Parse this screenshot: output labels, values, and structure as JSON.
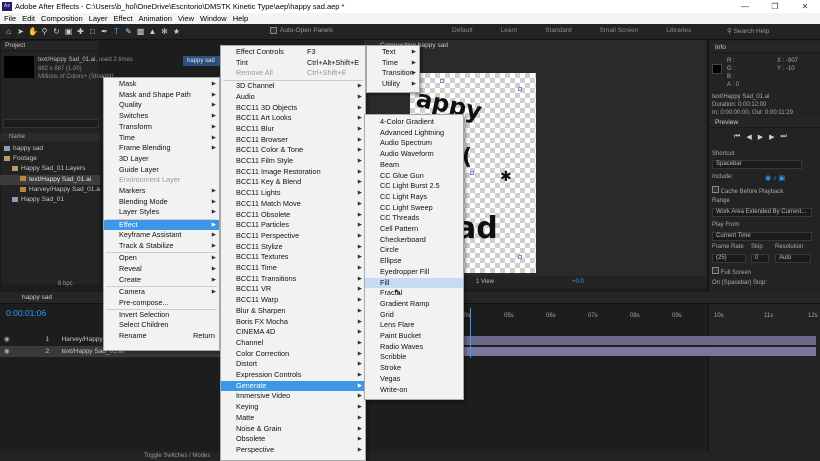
{
  "window": {
    "title": "Adobe After Effects - C:\\Users\\b_hol\\OneDrive\\Escritorio\\DMSTK Kinetic Type\\aep\\happy sad.aep *",
    "app_icon_text": "Ae"
  },
  "menubar": {
    "items": [
      "File",
      "Edit",
      "Composition",
      "Layer",
      "Effect",
      "Animation",
      "View",
      "Window",
      "Help"
    ]
  },
  "toolbar": {
    "auto_open_panels": "Auto-Open Panels",
    "workspaces": [
      "Default",
      "Learn",
      "Standard",
      "Small Screen",
      "Libraries"
    ],
    "search_help": "Search Help"
  },
  "project_panel": {
    "tab": "Project",
    "item_name": "text/Happy Sad_01.ai",
    "used": ", used 2 times",
    "dimensions": "882 x 887 (1.00)",
    "colors": "Millions of Colors+ (Straight)",
    "col_name": "Name",
    "tree": [
      {
        "label": "happy sad",
        "type": "comp",
        "indent": 0,
        "selected": false
      },
      {
        "label": "Footage",
        "type": "folder",
        "indent": 0,
        "selected": false
      },
      {
        "label": "Happy Sad_01 Layers",
        "type": "folder",
        "indent": 1,
        "selected": false
      },
      {
        "label": "text/Happy Sad_01.ai",
        "type": "ai",
        "indent": 2,
        "selected": true
      },
      {
        "label": "Harvey/Happy Sad_01.ai",
        "type": "ai",
        "indent": 2,
        "selected": false
      },
      {
        "label": "Happy Sad_01",
        "type": "comp",
        "indent": 1,
        "selected": false
      }
    ],
    "bpc": "8 bpc"
  },
  "comp_panel": {
    "tab": "Composition happy sad",
    "comp_tab_label": "happy sad",
    "canvas_text": [
      "appy",
      "ad"
    ],
    "zoom_view": "1 View",
    "offset": "+0.0"
  },
  "info_panel": {
    "tab": "Info",
    "r": "R :",
    "g": "G :",
    "b": "B :",
    "a": "A : 0",
    "x": "X : -907",
    "y": "Y : -10",
    "item": "text/Happy Sad_01.ai",
    "duration": "Duration: 0:00:12:00",
    "in": "In: 0:00:00:00, Out: 0:00:11:29"
  },
  "preview_panel": {
    "tab": "Preview",
    "shortcut_label": "Shortcut",
    "shortcut_value": "Spacebar",
    "include_label": "Include:",
    "cache_before": "Cache Before Playback",
    "range_label": "Range",
    "range_value": "Work Area Extended By Current...",
    "play_from_label": "Play From",
    "play_from_value": "Current Time",
    "frame_rate_label": "Frame Rate",
    "skip_label": "Skip",
    "resolution_label": "Resolution",
    "frame_rate_value": "(25)",
    "skip_value": "0",
    "resolution_value": "Auto",
    "full_screen": "Full Screen",
    "on_stop": "On (Spacebar) Stop:"
  },
  "timeline": {
    "tab": "happy sad",
    "timecode": "0:00:01:06",
    "layers": [
      {
        "num": "1",
        "name": "Harvey/Happy Sad_01.ai",
        "selected": false
      },
      {
        "num": "2",
        "name": "text/Happy Sad_01.ai",
        "selected": true
      }
    ],
    "ruler_labels": [
      "0s",
      "05s",
      "06s",
      "07s",
      "08s",
      "09s",
      "10s",
      "11s",
      "12s"
    ],
    "footer": "Toggle Switches / Modes"
  },
  "context_menu": {
    "items": [
      {
        "label": "Mask",
        "arrow": true
      },
      {
        "label": "Mask and Shape Path",
        "arrow": true
      },
      {
        "label": "Quality",
        "arrow": true
      },
      {
        "label": "Switches",
        "arrow": true
      },
      {
        "label": "Transform",
        "arrow": true
      },
      {
        "label": "Time",
        "arrow": true
      },
      {
        "label": "Frame Blending",
        "arrow": true
      },
      {
        "label": "3D Layer",
        "arrow": false
      },
      {
        "label": "Guide Layer",
        "arrow": false
      },
      {
        "label": "Environment Layer",
        "arrow": false,
        "disabled": true
      },
      {
        "label": "Markers",
        "arrow": true
      },
      {
        "label": "Blending Mode",
        "arrow": true
      },
      {
        "label": "Layer Styles",
        "arrow": true
      },
      {
        "label": "Effect",
        "arrow": true,
        "highlight": true
      },
      {
        "label": "Keyframe Assistant",
        "arrow": true
      },
      {
        "label": "Track & Stabilize",
        "arrow": true
      },
      {
        "label": "Open",
        "arrow": true
      },
      {
        "label": "Reveal",
        "arrow": true
      },
      {
        "label": "Create",
        "arrow": true
      },
      {
        "label": "Camera",
        "arrow": true
      },
      {
        "label": "Pre-compose...",
        "arrow": false
      },
      {
        "label": "Invert Selection",
        "arrow": false
      },
      {
        "label": "Select Children",
        "arrow": false
      },
      {
        "label": "Rename",
        "arrow": false,
        "shortcut": "Return"
      }
    ]
  },
  "effect_menu": {
    "top": [
      {
        "label": "Effect Controls",
        "shortcut": "F3"
      },
      {
        "label": "Tint",
        "shortcut": "Ctrl+Alt+Shift+E"
      },
      {
        "label": "Remove All",
        "shortcut": "Ctrl+Shift+E",
        "disabled": true
      }
    ],
    "items": [
      "3D Channel",
      "Audio",
      "BCC11 3D Objects",
      "BCC11 Art Looks",
      "BCC11 Blur",
      "BCC11 Browser",
      "BCC11 Color & Tone",
      "BCC11 Film Style",
      "BCC11 Image Restoration",
      "BCC11 Key & Blend",
      "BCC11 Lights",
      "BCC11 Match Move",
      "BCC11 Obsolete",
      "BCC11 Particles",
      "BCC11 Perspective",
      "BCC11 Stylize",
      "BCC11 Textures",
      "BCC11 Time",
      "BCC11 Transitions",
      "BCC11 VR",
      "BCC11 Warp",
      "Blur & Sharpen",
      "Boris FX Mocha",
      "CINEMA 4D",
      "Channel",
      "Color Correction",
      "Distort",
      "Expression Controls",
      "Generate",
      "Immersive Video",
      "Keying",
      "Matte",
      "Noise & Grain",
      "Obsolete",
      "Perspective"
    ],
    "highlight": "Generate"
  },
  "text_menu": {
    "items": [
      "Text",
      "Time",
      "Transition",
      "Utility"
    ]
  },
  "generate_menu": {
    "items": [
      "4-Color Gradient",
      "Advanced Lightning",
      "Audio Spectrum",
      "Audio Waveform",
      "Beam",
      "CC Glue Gun",
      "CC Light Burst 2.5",
      "CC Light Rays",
      "CC Light Sweep",
      "CC Threads",
      "Cell Pattern",
      "Checkerboard",
      "Circle",
      "Ellipse",
      "Eyedropper Fill",
      "Fill",
      "Fractal",
      "Gradient Ramp",
      "Grid",
      "Lens Flare",
      "Paint Bucket",
      "Radio Waves",
      "Scribble",
      "Stroke",
      "Vegas",
      "Write-on"
    ],
    "hover": "Fill"
  }
}
